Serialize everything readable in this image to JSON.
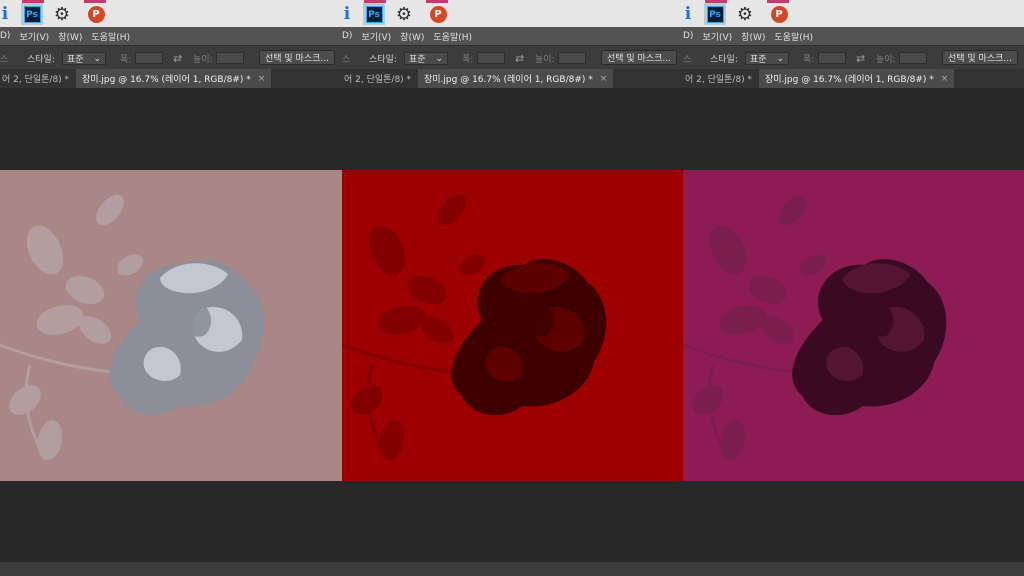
{
  "menu": {
    "d_tail": "D)",
    "view": "보기(V)",
    "window": "창(W)",
    "help": "도움말(H)"
  },
  "options": {
    "prefix": "스",
    "style_label": "스타일:",
    "style_value": "표준",
    "width_label": "폭:",
    "height_label": "높이:",
    "select_mask_button": "선택 및 마스크..."
  },
  "tabs": {
    "inactive_label": "어 2, 단일톤/8) *",
    "active_label": "장미.jpg @ 16.7% (레이어 1, RGB/8#) *",
    "close": "×"
  },
  "taskbar": {
    "ps_label": "Ps",
    "ppt_label": "P",
    "gear_glyph": "⚙",
    "info_glyph": "i",
    "accent_color": "#c43b6f"
  },
  "canvases": [
    {
      "name": "gray-tone",
      "background": "#a98786",
      "rose_color": "#8c8f99",
      "rose_highlight": "#c4c7cf",
      "leaf_color": "#b6a6a8"
    },
    {
      "name": "red-tone",
      "background": "#9d0000",
      "rose_color": "#3f0000",
      "rose_highlight": "#5e0000",
      "leaf_color": "#7a0000"
    },
    {
      "name": "magenta-tone",
      "background": "#8d1c55",
      "rose_color": "#3a0a22",
      "rose_highlight": "#531531",
      "leaf_color": "#74204a"
    }
  ]
}
